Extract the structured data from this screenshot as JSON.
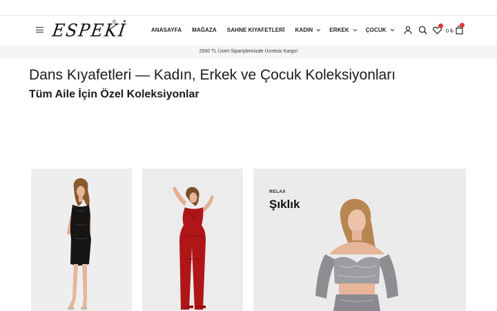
{
  "header": {
    "logo_text": "ESPEKİ",
    "logo_reg": "®",
    "nav": [
      {
        "label": "ANASAYFA",
        "has_dropdown": false
      },
      {
        "label": "MAĞAZA",
        "has_dropdown": false
      },
      {
        "label": "SAHNE KIYAFETLERİ",
        "has_dropdown": false
      },
      {
        "label": "KADIN",
        "has_dropdown": true
      },
      {
        "label": "ERKEK",
        "has_dropdown": true
      },
      {
        "label": "ÇOCUK",
        "has_dropdown": true
      }
    ],
    "icons": [
      "menu-icon",
      "user-icon",
      "search-icon",
      "heart-icon",
      "cart-icon"
    ],
    "cart_total": "0 ₺",
    "badge_color": "#e53935"
  },
  "promo": {
    "text": "2500 TL Üzeri Siparişlerinizde Ücretsiz Kargo!"
  },
  "hero": {
    "title": "Dans Kıyafetleri — Kadın, Erkek ve Çocuk Koleksiyonları",
    "subtitle": "Tüm Aile İçin Özel Koleksiyonlar"
  },
  "cards": [
    {
      "product": "black sequin mini dress"
    },
    {
      "product": "red sequin jumpsuit"
    },
    {
      "eyebrow": "RELAX",
      "title": "Şıklık",
      "product": "silver sequin crop top and skirt"
    }
  ]
}
